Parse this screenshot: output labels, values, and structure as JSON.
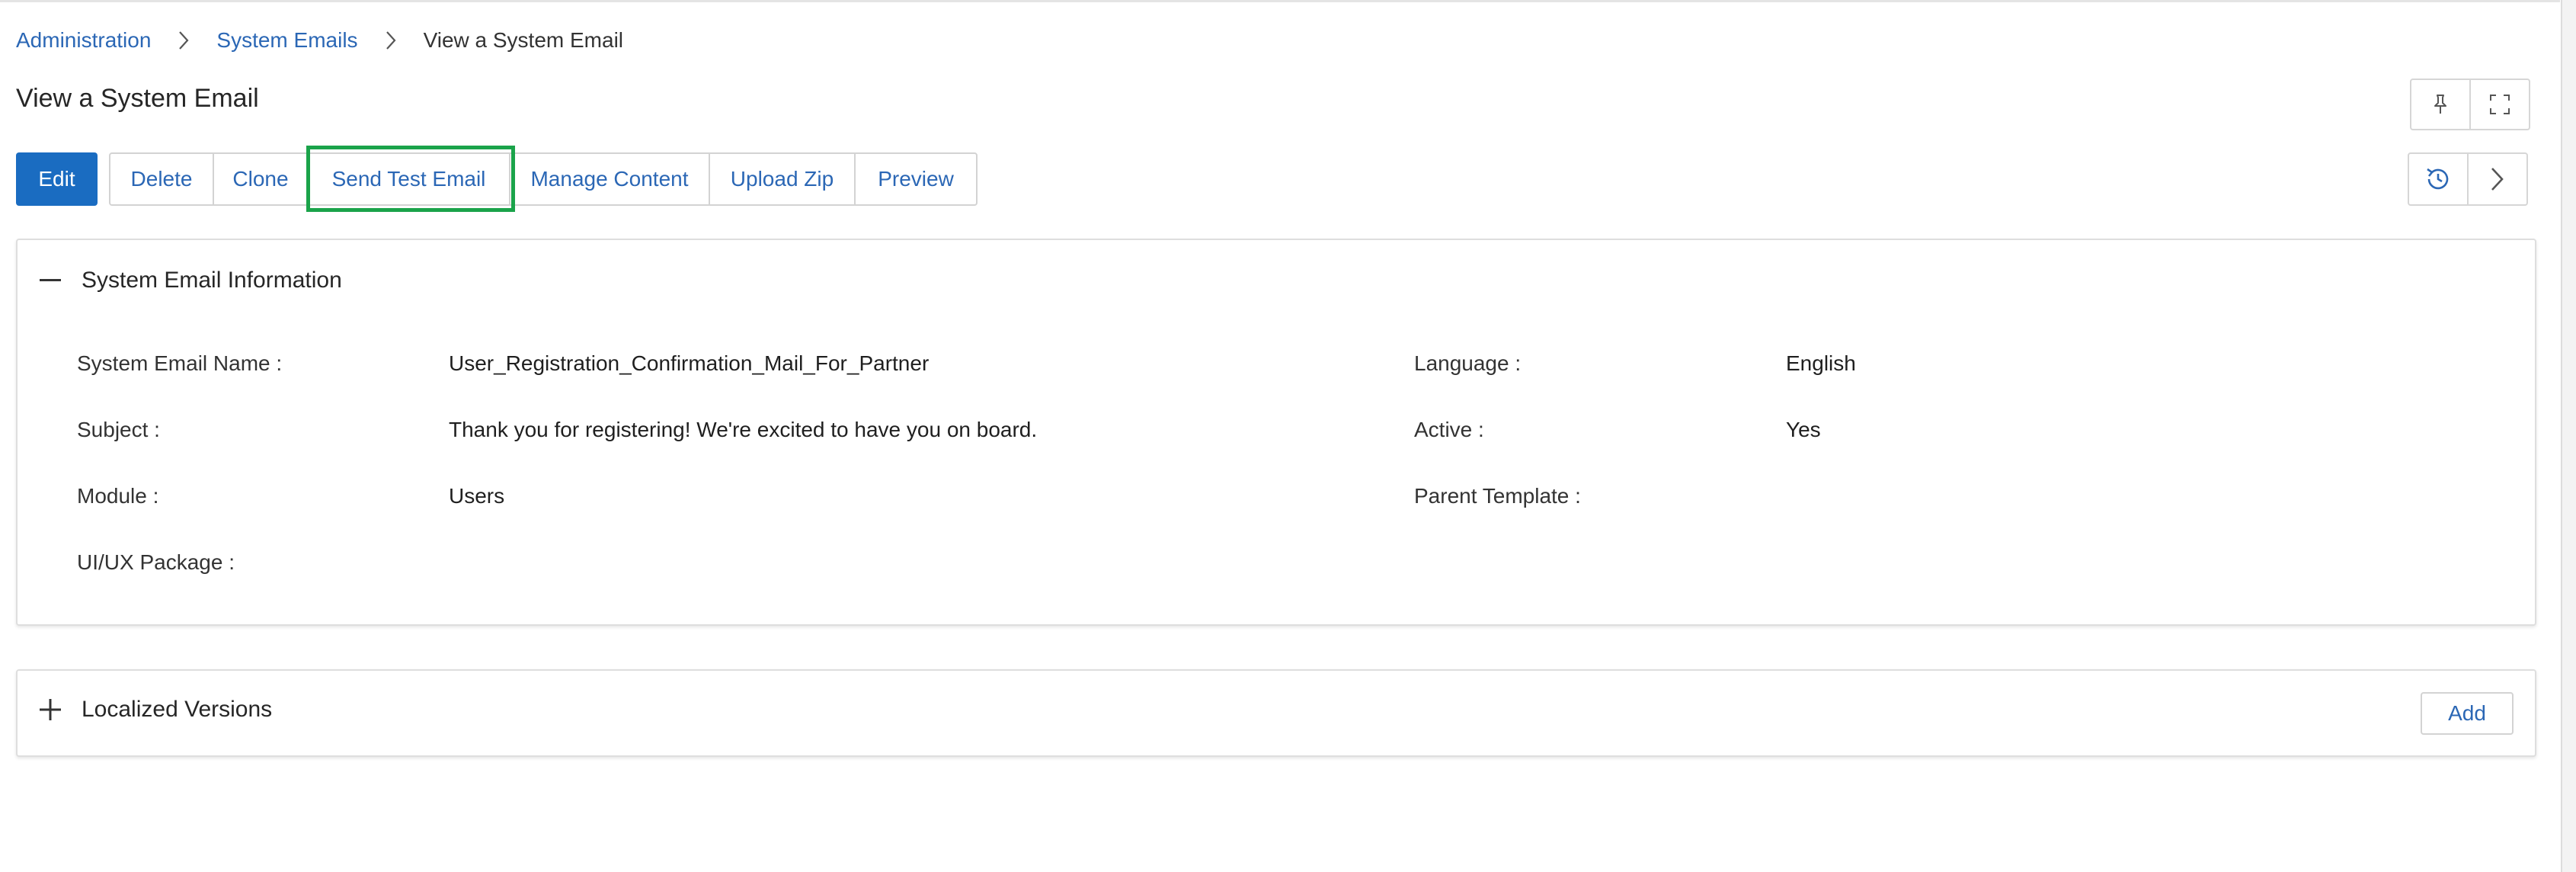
{
  "breadcrumb": {
    "items": [
      "Administration",
      "System Emails"
    ],
    "current": "View a System Email"
  },
  "page": {
    "title": "View a System Email"
  },
  "toolbar": {
    "edit": "Edit",
    "delete": "Delete",
    "clone": "Clone",
    "send_test_email": "Send Test Email",
    "manage_content": "Manage Content",
    "upload_zip": "Upload Zip",
    "preview": "Preview"
  },
  "top_icons": [
    "pin-icon",
    "fullscreen-icon",
    "history-icon",
    "chevron-right-icon"
  ],
  "info_panel": {
    "title": "System Email Information",
    "fields": {
      "name_label": "System Email Name :",
      "name_value": "User_Registration_Confirmation_Mail_For_Partner",
      "language_label": "Language :",
      "language_value": "English",
      "subject_label": "Subject :",
      "subject_value": "Thank you for registering! We're excited to have you on board.",
      "active_label": "Active :",
      "active_value": "Yes",
      "module_label": "Module :",
      "module_value": "Users",
      "parent_label": "Parent Template :",
      "parent_value": "",
      "uiux_label": "UI/UX Package :",
      "uiux_value": ""
    }
  },
  "localized_panel": {
    "title": "Localized Versions",
    "add": "Add"
  },
  "colors": {
    "primary": "#1a6cc1",
    "link": "#2b67b5",
    "highlight": "#1aa34a",
    "border": "#d3d3d3"
  }
}
